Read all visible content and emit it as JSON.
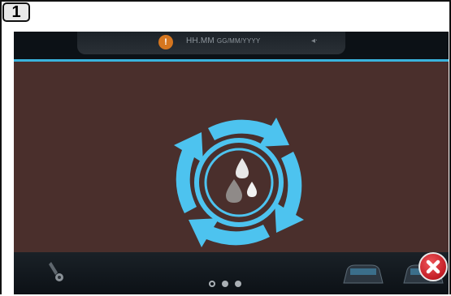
{
  "step": {
    "number": "1"
  },
  "statusbar": {
    "warning_icon": "warning-icon",
    "time_format": "HH.MM",
    "date_format": "GG/MM/YYYY",
    "mute_icon": "speaker-muted-icon"
  },
  "popup": {
    "graphic_icon": "fluid-cycle-icon",
    "accent_color": "#3ab3dd",
    "background_color": "#4a2f2c",
    "close_icon": "close-icon"
  },
  "pager": {
    "pages": 3,
    "active_page": 1
  }
}
